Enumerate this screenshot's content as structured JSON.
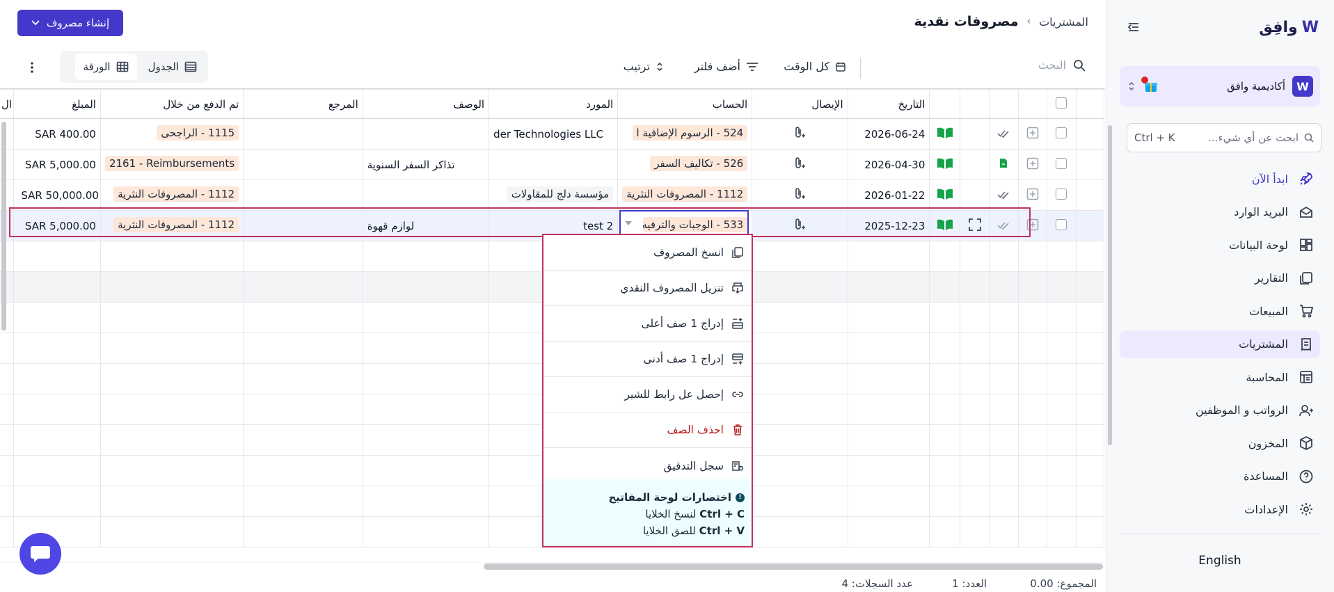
{
  "sidebar": {
    "brand": "وافِق",
    "org_name": "أكاديمية وافق",
    "org_initial": "W",
    "search_placeholder": "ابحث عن أي شيء...",
    "search_shortcut": "Ctrl + K",
    "items": [
      {
        "label": "ابدأ الآن",
        "icon": "rocket-icon"
      },
      {
        "label": "البريد الوارد",
        "icon": "inbox-icon"
      },
      {
        "label": "لوحة البيانات",
        "icon": "dashboard-icon"
      },
      {
        "label": "التقارير",
        "icon": "reports-icon"
      },
      {
        "label": "المبيعات",
        "icon": "cart-icon"
      },
      {
        "label": "المشتريات",
        "icon": "receipt-icon"
      },
      {
        "label": "المحاسبة",
        "icon": "ledger-icon"
      },
      {
        "label": "الرواتب و الموظفين",
        "icon": "users-icon"
      },
      {
        "label": "المخزون",
        "icon": "box-icon"
      },
      {
        "label": "المساعدة",
        "icon": "help-icon"
      },
      {
        "label": "الإعدادات",
        "icon": "gear-icon"
      }
    ],
    "language": "English"
  },
  "header": {
    "breadcrumb_parent": "المشتريات",
    "title": "مصروفات نقدية",
    "create_label": "إنشاء مصروف"
  },
  "toolbar": {
    "search_placeholder": "البحث",
    "time_filter": "كل الوقت",
    "add_filter": "أضف فلتر",
    "sort": "ترتيب",
    "view_table": "الجدول",
    "view_sheet": "الورقة"
  },
  "table": {
    "columns": {
      "date": "التاريخ",
      "receipt": "الإيصال",
      "account": "الحساب",
      "vendor": "المورد",
      "description": "الوصف",
      "reference": "المرجع",
      "paid_through": "تم الدفع من خلال",
      "amount": "المبلغ",
      "next": "ال"
    },
    "rows": [
      {
        "date": "2026-06-24",
        "account": "524 - الرسوم الإضافية ا",
        "vendor": "der Technologies LLC",
        "description": "",
        "reference": "",
        "paid_through": "1115 - الراجحى",
        "amount": "SAR 400.00"
      },
      {
        "date": "2026-04-30",
        "account": "526 - تكاليف السفر",
        "vendor": "",
        "description": "تذاكر السفر السنوية",
        "reference": "",
        "paid_through": "2161 - Reimbursements",
        "amount": "SAR 5,000.00"
      },
      {
        "date": "2026-01-22",
        "account": "1112 - المصروفات النثرية",
        "vendor": "مؤسسة دلج للمقاولات",
        "description": "",
        "reference": "",
        "paid_through": "1112 - المصروفات النثرية",
        "amount": "SAR 50,000.00"
      },
      {
        "date": "2025-12-23",
        "account": "533 - الوجبات والترفيه",
        "vendor": "test 2",
        "description": "لوازم قهوة",
        "reference": "",
        "paid_through": "1112 - المصروفات النثرية",
        "amount": "SAR 5,000.00"
      }
    ]
  },
  "context_menu": {
    "items": [
      {
        "label": "انسخ المصروف",
        "icon": "copy-icon"
      },
      {
        "label": "تنزيل المصروف النقدي",
        "icon": "print-download-icon"
      },
      {
        "label": "إدراج 1 صف أعلى",
        "icon": "insert-above-icon"
      },
      {
        "label": "إدراج 1 صف أدنى",
        "icon": "insert-below-icon"
      },
      {
        "label": "إحصل عل رابط للشير",
        "icon": "link-icon"
      },
      {
        "label": "احذف الصف",
        "icon": "trash-icon"
      },
      {
        "label": "سجل التدقيق",
        "icon": "audit-log-icon"
      }
    ],
    "hint_title": "اختصارات لوحة المفاتيح",
    "hint_copy_key": "Ctrl + C",
    "hint_copy_text": "لنسخ الخلايا",
    "hint_paste_key": "Ctrl + V",
    "hint_paste_text": "للصق الخلايا"
  },
  "footer": {
    "sum": "المجموع: 0.00",
    "count": "العدد: 1",
    "records": "عدد السجلات: 4"
  },
  "colors": {
    "accent": "#4338ca",
    "highlight": "#c0325e",
    "tag": "#fde7d9"
  }
}
